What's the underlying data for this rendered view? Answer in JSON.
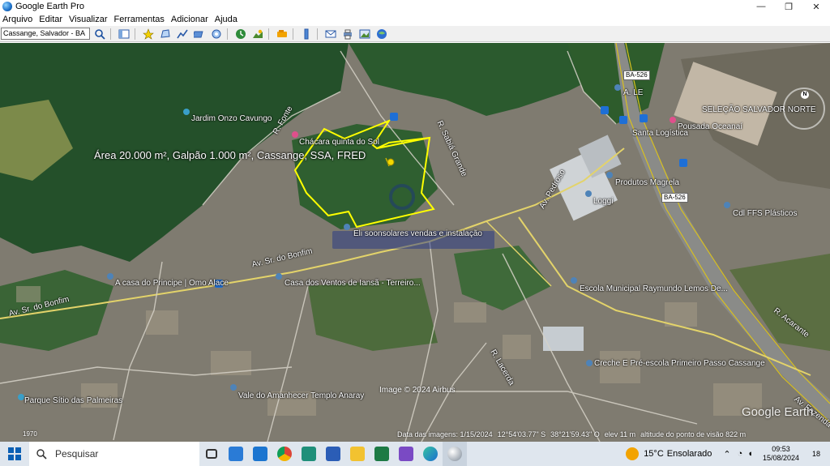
{
  "window": {
    "title": "Google Earth Pro",
    "min_glyph": "—",
    "max_glyph": "❐",
    "close_glyph": "✕"
  },
  "menu": [
    "Arquivo",
    "Editar",
    "Visualizar",
    "Ferramentas",
    "Adicionar",
    "Ajuda"
  ],
  "search": {
    "value": "Cassange, Salvador - BA"
  },
  "toolbar_icons": [
    "search-icon",
    "sidebar-icon",
    "placemark-icon",
    "polygon-icon",
    "path-icon",
    "overlay-icon",
    "tour-icon",
    "history-icon",
    "sun-icon",
    "planets-icon",
    "ruler-icon",
    "email-icon",
    "print-icon",
    "save-image-icon",
    "maps-icon"
  ],
  "map": {
    "annotation": "Área 20.000 m², Galpão 1.000 m², Cassange, SSA, FRED",
    "labels": {
      "jardim": "Jardim Onzo Cavungo",
      "chacara": "Chácara quinta do Sol",
      "paineis": "Eli soonsolares vendas e instalação",
      "bonfim1": "Av. Sr. do Bonfim",
      "bonfim2": "Av. Sr. do Bonfim",
      "casa_alace": "A casa do Principe | Omo Alace",
      "ventos": "Casa dos Ventos de Iansã - Terreiro...",
      "escola": "Escola Municipal Raymundo Lemos De...",
      "creche": "Creche E Pré-escola Primeiro Passo Cassange",
      "parque": "Parque Sítio das Palmeiras",
      "vale": "Vale do Amanhecer Templo Anaray",
      "selecao": "SELEÇÃO SALVADOR NORTE",
      "pousada": "Pousada Oceanaí",
      "santa": "Santa Logística",
      "magrela": "Produtos Magrela",
      "loggi": "Loggi",
      "ffs": "Cdl FFS Plásticos",
      "ale": "A. LE",
      "br526a": "BA-526",
      "br526b": "BA-526",
      "acarante": "R. Acarante",
      "fazenda": "Av. Fazenda",
      "pedroso": "Av. Pedroso",
      "sao_sab": "R. Sabiá Grande",
      "fuente": "R. Fonte",
      "r_lacerda": "R. Lacerda"
    },
    "copyright": "Image © 2024 Airbus",
    "watermark": "Google Earth",
    "scale_label": "1970",
    "compass_label": "N"
  },
  "statusbar": {
    "date": "Data das imagens: 1/15/2024",
    "lat": "12°54'03.77\" S",
    "lon": "38°21'59.43\" O",
    "elev": "elev   11 m",
    "eye": "altitude do ponto de visão   822 m"
  },
  "taskbar": {
    "search_placeholder": "Pesquisar",
    "weather_temp": "15°C",
    "weather_desc": "Ensolarado",
    "time": "09:53",
    "date": "15/08/2024",
    "notif": "18"
  },
  "colors": {
    "boundary": "#ffff00",
    "pin": "#f2d800",
    "vegetation": "#1f4a1f",
    "urban": "#8a8476"
  }
}
